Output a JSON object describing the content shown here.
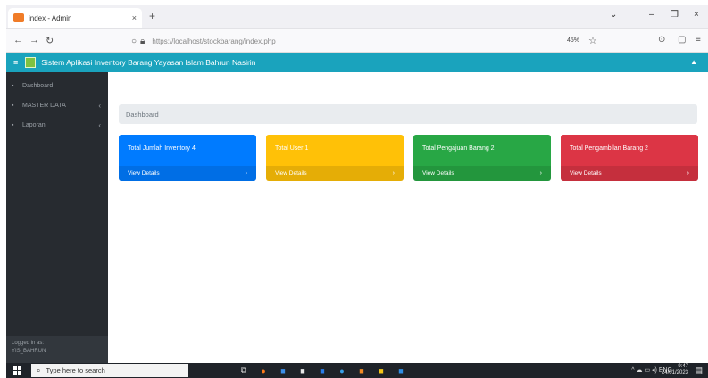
{
  "browser": {
    "tab_title": "index - Admin",
    "tab_close": "×",
    "new_tab": "+",
    "controls": {
      "minimize": "–",
      "maximize": "❐",
      "close": "×"
    },
    "back": "←",
    "forward": "→",
    "reload": "↻",
    "url": "https://localhost/stockbarang/index.php",
    "zoom": "45%",
    "star": "☆"
  },
  "app": {
    "menu_icon": "≡",
    "title": "Sistem Aplikasi Inventory Barang Yayasan Islam Bahrun Nasirin",
    "user_icon": "▲",
    "sidebar": {
      "items": [
        {
          "icon": "▪",
          "label": "Dashboard",
          "caret": ""
        },
        {
          "icon": "▪",
          "label": "MASTER DATA",
          "caret": "‹"
        },
        {
          "icon": "▪",
          "label": "Laporan",
          "caret": "‹"
        }
      ],
      "footer_line1": "Logged in as:",
      "footer_line2": "YIS_BAHRUN"
    },
    "breadcrumb": "Dashboard",
    "cards": [
      {
        "title": "Total Jumlah Inventory 4",
        "footer": "View Details",
        "arrow": "›",
        "color": "#007bff"
      },
      {
        "title": "Total User 1",
        "footer": "View Details",
        "arrow": "›",
        "color": "#ffc107"
      },
      {
        "title": "Total Pengajuan Barang 2",
        "footer": "View Details",
        "arrow": "›",
        "color": "#28a745"
      },
      {
        "title": "Total Pengambilan Barang 2",
        "footer": "View Details",
        "arrow": "›",
        "color": "#dc3545"
      }
    ]
  },
  "taskbar": {
    "search_placeholder": "Type here to search",
    "time": "9:47",
    "date": "24/01/2023"
  }
}
